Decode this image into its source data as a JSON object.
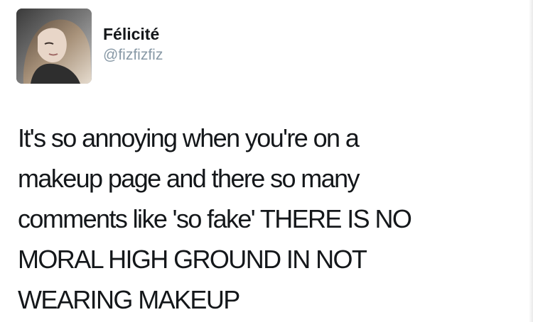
{
  "tweet": {
    "author": {
      "display_name": "Félicité",
      "handle": "@fizfizfiz",
      "avatar_icon": "profile-photo-avatar"
    },
    "text_lines": [
      "It's so annoying when you're on a",
      "makeup page and there so many",
      "comments like 'so fake' THERE IS NO",
      "MORAL HIGH GROUND IN NOT",
      "WEARING MAKEUP"
    ]
  },
  "colors": {
    "text": "#14171a",
    "handle": "#8899a6",
    "background": "#ffffff"
  }
}
